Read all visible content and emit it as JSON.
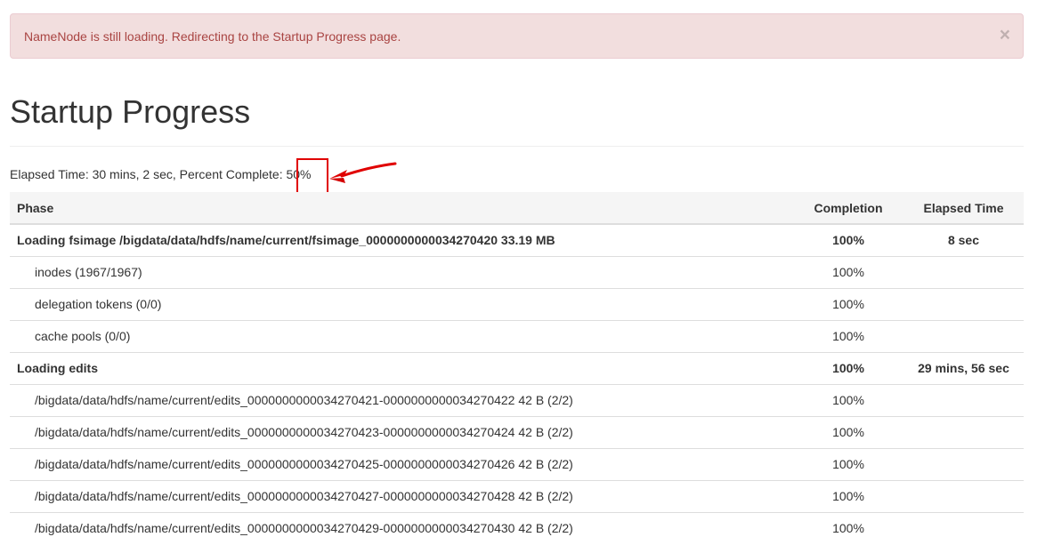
{
  "alert": {
    "message": "NameNode is still loading. Redirecting to the Startup Progress page.",
    "close_glyph": "×"
  },
  "page_title": "Startup Progress",
  "summary": {
    "text": "Elapsed Time: 30 mins, 2 sec, Percent Complete: 50%",
    "percent_complete": 50
  },
  "table": {
    "headers": {
      "phase": "Phase",
      "completion": "Completion",
      "elapsed": "Elapsed Time"
    },
    "rows": [
      {
        "type": "phase",
        "phase": "Loading fsimage /bigdata/data/hdfs/name/current/fsimage_0000000000034270420 33.19 MB",
        "completion": "100%",
        "elapsed": "8 sec"
      },
      {
        "type": "step",
        "phase": "inodes (1967/1967)",
        "completion": "100%",
        "elapsed": ""
      },
      {
        "type": "step",
        "phase": "delegation tokens (0/0)",
        "completion": "100%",
        "elapsed": ""
      },
      {
        "type": "step",
        "phase": "cache pools (0/0)",
        "completion": "100%",
        "elapsed": ""
      },
      {
        "type": "phase",
        "phase": "Loading edits",
        "completion": "100%",
        "elapsed": "29 mins, 56 sec"
      },
      {
        "type": "step",
        "phase": "/bigdata/data/hdfs/name/current/edits_0000000000034270421-0000000000034270422 42 B (2/2)",
        "completion": "100%",
        "elapsed": ""
      },
      {
        "type": "step",
        "phase": "/bigdata/data/hdfs/name/current/edits_0000000000034270423-0000000000034270424 42 B (2/2)",
        "completion": "100%",
        "elapsed": ""
      },
      {
        "type": "step",
        "phase": "/bigdata/data/hdfs/name/current/edits_0000000000034270425-0000000000034270426 42 B (2/2)",
        "completion": "100%",
        "elapsed": ""
      },
      {
        "type": "step",
        "phase": "/bigdata/data/hdfs/name/current/edits_0000000000034270427-0000000000034270428 42 B (2/2)",
        "completion": "100%",
        "elapsed": ""
      },
      {
        "type": "step",
        "phase": "/bigdata/data/hdfs/name/current/edits_0000000000034270429-0000000000034270430 42 B (2/2)",
        "completion": "100%",
        "elapsed": ""
      }
    ]
  },
  "annotation": {
    "highlight_color": "#e00000",
    "shape": "red-box-with-arrow"
  },
  "colors": {
    "alert_bg": "#f2dede",
    "alert_text": "#a94442",
    "table_header_bg": "#f5f5f5"
  }
}
